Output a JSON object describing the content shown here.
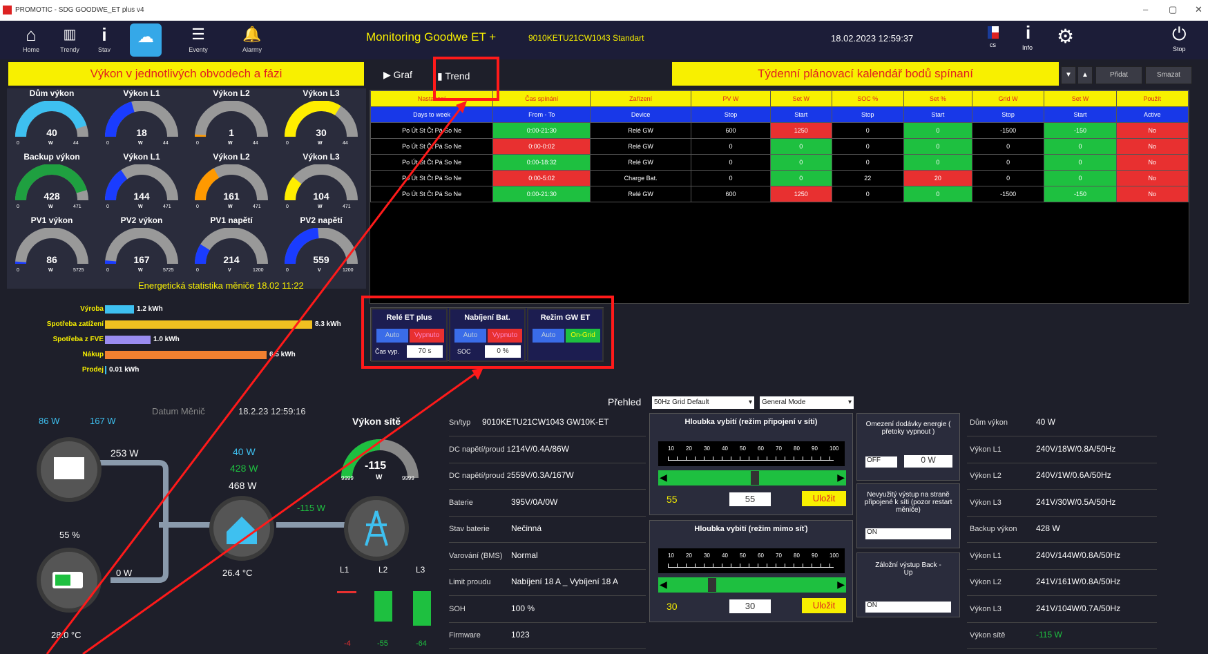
{
  "window": {
    "title": "PROMOTIC - SDG GOODWE_ET plus  v4"
  },
  "nav": [
    {
      "label": "Home",
      "icon": "home-icon"
    },
    {
      "label": "Trendy",
      "icon": "bar-chart-icon"
    },
    {
      "label": "Stav",
      "icon": "info-icon"
    },
    {
      "label": "",
      "icon": "cloud-icon"
    },
    {
      "label": "Eventy",
      "icon": "list-icon"
    },
    {
      "label": "Alarmy",
      "icon": "bell-icon"
    }
  ],
  "header": {
    "title": "Monitoring Goodwe ET +",
    "serial": "9010KETU21CW1043 Standart",
    "datetime": "18.02.2023 12:59:37",
    "lang": "cs",
    "info_label": "Info",
    "stop_label": "Stop"
  },
  "left": {
    "title": "Výkon v jednotlivých obvodech a fázi",
    "gauges": [
      {
        "label": "Dům výkon",
        "value": "40",
        "unit": "W",
        "min": "0",
        "max": "44",
        "level": 0.9,
        "color": "#3ec0f0"
      },
      {
        "label": "Výkon L1",
        "value": "18",
        "unit": "W",
        "min": "0",
        "max": "44",
        "level": 0.41,
        "color": "#1a3cff"
      },
      {
        "label": "Výkon L2",
        "value": "1",
        "unit": "W",
        "min": "0",
        "max": "44",
        "level": 0.02,
        "color": "#ff9900"
      },
      {
        "label": "Výkon L3",
        "value": "30",
        "unit": "W",
        "min": "0",
        "max": "44",
        "level": 0.68,
        "color": "#ffee00"
      },
      {
        "label": "Backup výkon",
        "value": "428",
        "unit": "W",
        "min": "0",
        "max": "471",
        "level": 0.91,
        "color": "#1fa040"
      },
      {
        "label": "Výkon L1",
        "value": "144",
        "unit": "W",
        "min": "0",
        "max": "471",
        "level": 0.31,
        "color": "#1a3cff"
      },
      {
        "label": "Výkon L2",
        "value": "161",
        "unit": "W",
        "min": "0",
        "max": "471",
        "level": 0.34,
        "color": "#ff9900"
      },
      {
        "label": "Výkon L3",
        "value": "104",
        "unit": "W",
        "min": "0",
        "max": "471",
        "level": 0.22,
        "color": "#ffee00"
      },
      {
        "label": "PV1 výkon",
        "value": "86",
        "unit": "W",
        "min": "0",
        "max": "5725",
        "level": 0.02,
        "color": "#1a3cff"
      },
      {
        "label": "PV2 výkon",
        "value": "167",
        "unit": "W",
        "min": "0",
        "max": "5725",
        "level": 0.03,
        "color": "#1a3cff"
      },
      {
        "label": "PV1 napětí",
        "value": "214",
        "unit": "V",
        "min": "0",
        "max": "1200",
        "level": 0.18,
        "color": "#1a3cff"
      },
      {
        "label": "PV2 napětí",
        "value": "559",
        "unit": "V",
        "min": "0",
        "max": "1200",
        "level": 0.47,
        "color": "#1a3cff"
      }
    ],
    "stats_title": "Energetická statistika měniče  18.02 11:22",
    "stats": [
      {
        "label": "Výroba",
        "value": "1.2 kWh",
        "fraction": 0.14,
        "color": "#3ec0f0"
      },
      {
        "label": "Spotřeba zatížení",
        "value": "8.3 kWh",
        "fraction": 1.0,
        "color": "#f0c020"
      },
      {
        "label": "Spotřeba z FVE",
        "value": "1.0 kWh",
        "fraction": 0.22,
        "color": "#9a8cf0"
      },
      {
        "label": "Nákup",
        "value": "6.5 kWh",
        "fraction": 0.78,
        "color": "#f08030"
      },
      {
        "label": "Prodej",
        "value": "0.01 kWh",
        "fraction": 0.0,
        "color": "#3ec0f0"
      }
    ]
  },
  "flow": {
    "pv1": "86 W",
    "pv2": "167 W",
    "datum_label": "Datum Měnič",
    "datum_value": "18.2.23 12:59:16",
    "pv_total": "253 W",
    "home_w1": "40 W",
    "home_w2": "428 W",
    "home_w3": "468 W",
    "grid_w": "-115 W",
    "battery_pct": "55 %",
    "battery_w": "0 W",
    "temp_home": "26.4 °C",
    "temp_batt": "28.0 °C",
    "grid_power_label": "Výkon sítě",
    "grid_power_value": "-115",
    "grid_power_unit": "W",
    "grid_min": "9999",
    "grid_max": "9999",
    "phases": [
      "L1",
      "L2",
      "L3"
    ],
    "phase_values": [
      "-4",
      "-55",
      "-64"
    ]
  },
  "tabs": {
    "graf": "Graf",
    "trend": "Trend"
  },
  "calendar": {
    "title": "Týdenní plánovací kalendář bodů spínaní",
    "add": "Přidat",
    "delete": "Smazat",
    "headers": [
      "Nastavení",
      "Čas spínání",
      "Zařízení",
      "PV W",
      "Set W",
      "SOC %",
      "Set %",
      "Grid W",
      "Set W",
      "Použít"
    ],
    "subheaders": [
      "Days to week",
      "From - To",
      "Device",
      "Stop",
      "Start",
      "Stop",
      "Start",
      "Stop",
      "Start",
      "Active"
    ],
    "rows": [
      [
        "Po Út St Čt Pá So Ne",
        "0:00-21:30",
        "Relé GW",
        "600",
        "1250",
        "0",
        "0",
        "-1500",
        "-150",
        "No"
      ],
      [
        "Po Út St Čt Pá So Ne",
        "0:00-0:02",
        "Relé GW",
        "0",
        "0",
        "0",
        "0",
        "0",
        "0",
        "No"
      ],
      [
        "Po Út St Čt Pá So Ne",
        "0:00-18:32",
        "Relé GW",
        "0",
        "0",
        "0",
        "0",
        "0",
        "0",
        "No"
      ],
      [
        "Po Út St Čt Pá So Ne",
        "0:00-5:02",
        "Charge Bat.",
        "0",
        "0",
        "22",
        "20",
        "0",
        "0",
        "No"
      ],
      [
        "Po Út St Čt Pá So Ne",
        "0:00-21:30",
        "Relé GW",
        "600",
        "1250",
        "0",
        "0",
        "-1500",
        "-150",
        "No"
      ]
    ]
  },
  "controls": {
    "rele": {
      "title": "Relé ET plus",
      "auto": "Auto",
      "state": "Vypnuto",
      "cas_label": "Čas vyp.",
      "cas_value": "70 s"
    },
    "nab": {
      "title": "Nabíjení Bat.",
      "auto": "Auto",
      "state": "Vypnuto",
      "soc_label": "SOC",
      "soc_value": "0 %"
    },
    "rezim": {
      "title": "Režim GW ET",
      "auto": "Auto",
      "state": "On-Grid"
    }
  },
  "overview": {
    "label": "Přehled",
    "grid_select": "50Hz Grid Default",
    "mode_select": "General Mode",
    "info": [
      {
        "k": "Sn/typ",
        "v": "9010KETU21CW1043 GW10K-ET"
      },
      {
        "k": "DC napětí/proud 1",
        "v": "214V/0.4A/86W"
      },
      {
        "k": "DC napětí/proud 2",
        "v": "559V/0.3A/167W"
      },
      {
        "k": "Baterie",
        "v": "395V/0A/0W"
      },
      {
        "k": "Stav baterie",
        "v": "Nečinná"
      },
      {
        "k": "Varování (BMS)",
        "v": "Normal"
      },
      {
        "k": "Limit proudu",
        "v": "Nabíjení 18 A _ Vybíjení 18 A"
      },
      {
        "k": "SOH",
        "v": "100 %"
      },
      {
        "k": "Firmware",
        "v": "1023"
      }
    ],
    "depth1": {
      "title": "Hloubka vybití (režim připojení v síti)",
      "value": "55",
      "input": "55",
      "save": "Uložit",
      "fraction": 0.5
    },
    "depth2": {
      "title": "Hloubka vybití (režim mimo síť)",
      "value": "30",
      "input": "30",
      "save": "Uložit",
      "fraction": 0.28
    },
    "scale": [
      "10",
      "20",
      "30",
      "40",
      "50",
      "60",
      "70",
      "80",
      "90",
      "100"
    ],
    "limit": {
      "title": "Omezení dodávky energie ( přetoky vypnout )",
      "select": "OFF",
      "value": "0 W"
    },
    "unused": {
      "title": "Nevyužitý výstup na straně připojené k síti (pozor restart měniče)",
      "select": "ON"
    },
    "backup": {
      "title": "Záložní výstup Back - Up",
      "select": "ON"
    },
    "right": [
      {
        "k": "Dům výkon",
        "v": "40 W"
      },
      {
        "k": "Výkon L1",
        "v": "240V/18W/0.8A/50Hz"
      },
      {
        "k": "Výkon L2",
        "v": "240V/1W/0.6A/50Hz"
      },
      {
        "k": "Výkon L3",
        "v": "241V/30W/0.5A/50Hz"
      },
      {
        "k": "Backup výkon",
        "v": "428 W"
      },
      {
        "k": "Výkon L1",
        "v": "240V/144W/0.8A/50Hz"
      },
      {
        "k": "Výkon L2",
        "v": "241V/161W/0.8A/50Hz"
      },
      {
        "k": "Výkon L3",
        "v": "241V/104W/0.7A/50Hz"
      },
      {
        "k": "Výkon sítě",
        "v": "-115 W"
      }
    ]
  },
  "colors": {
    "yellow": "#f8f000",
    "red": "#e83030",
    "green": "#1ec040",
    "blue": "#1838e8",
    "annotation": "#ff1a1a"
  }
}
